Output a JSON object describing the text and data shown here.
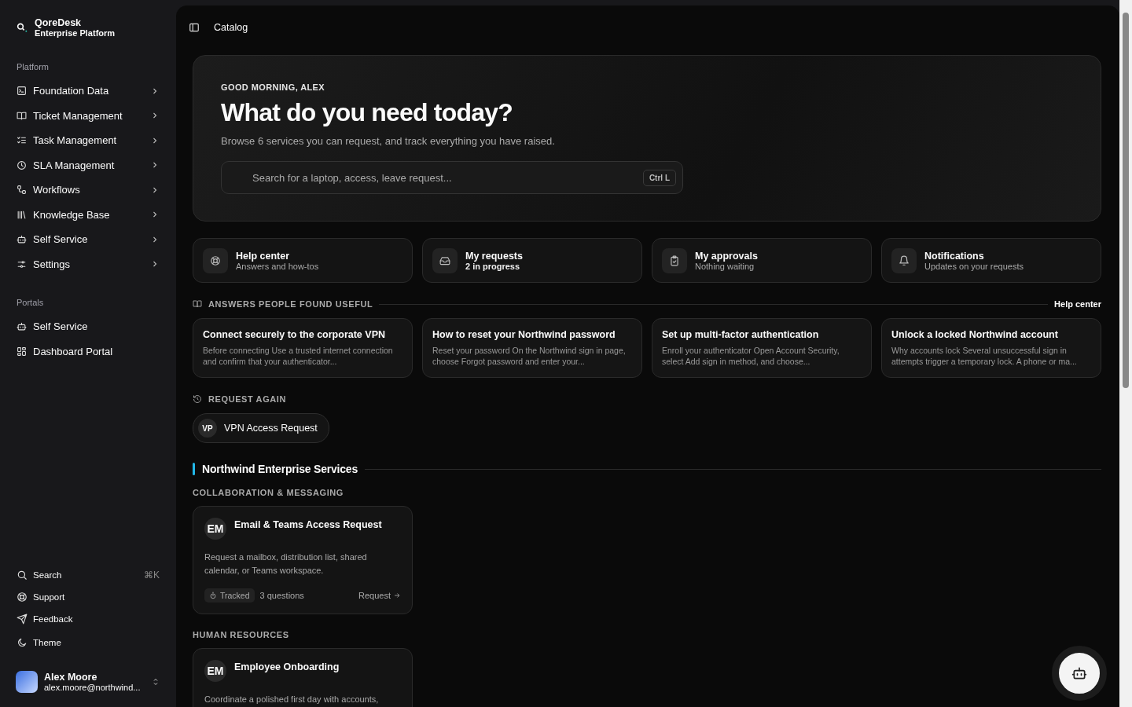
{
  "brand": {
    "name": "QoreDesk",
    "subtitle": "Enterprise Platform"
  },
  "sidebar": {
    "platform_label": "Platform",
    "platform_items": [
      {
        "label": "Foundation Data",
        "expanded": false
      },
      {
        "label": "Ticket Management",
        "expanded": false
      },
      {
        "label": "Task Management",
        "expanded": false
      },
      {
        "label": "SLA Management",
        "expanded": false
      },
      {
        "label": "Workflows",
        "expanded": false
      },
      {
        "label": "Knowledge Base",
        "expanded": false
      },
      {
        "label": "Self Service",
        "expanded": false
      },
      {
        "label": "Settings",
        "expanded": false
      }
    ],
    "portals_label": "Portals",
    "portal_items": [
      {
        "label": "Self Service"
      },
      {
        "label": "Dashboard Portal"
      }
    ],
    "footer_items": [
      {
        "label": "Search",
        "shortcut": "⌘K"
      },
      {
        "label": "Support"
      },
      {
        "label": "Feedback"
      },
      {
        "label": "Theme"
      }
    ],
    "user": {
      "name": "Alex Moore",
      "email": "alex.moore@northwind..."
    }
  },
  "header": {
    "title": "Catalog"
  },
  "hero": {
    "greeting": "GOOD MORNING, ALEX",
    "heading": "What do you need today?",
    "subtitle": "Browse 6 services you can request, and track everything you have raised.",
    "search": {
      "placeholder": "Search for a laptop, access, leave request...",
      "shortcut": "Ctrl L"
    }
  },
  "quick_links": [
    {
      "title": "Help center",
      "subtitle": "Answers and how-tos",
      "emphasis": false
    },
    {
      "title": "My requests",
      "subtitle": "2 in progress",
      "emphasis": true
    },
    {
      "title": "My approvals",
      "subtitle": "Nothing waiting",
      "emphasis": false
    },
    {
      "title": "Notifications",
      "subtitle": "Updates on your requests",
      "emphasis": false
    }
  ],
  "answers": {
    "heading": "ANSWERS PEOPLE FOUND USEFUL",
    "link": "Help center",
    "articles": [
      {
        "title": "Connect securely to the corporate VPN",
        "excerpt": "Before connecting Use a trusted internet connection and confirm that your authenticator..."
      },
      {
        "title": "How to reset your Northwind password",
        "excerpt": "Reset your password On the Northwind sign in page, choose Forgot password and enter your..."
      },
      {
        "title": "Set up multi-factor authentication",
        "excerpt": "Enroll your authenticator Open Account Security, select Add sign in method, and choose..."
      },
      {
        "title": "Unlock a locked Northwind account",
        "excerpt": "Why accounts lock Several unsuccessful sign in attempts trigger a temporary lock. A phone or ma..."
      }
    ]
  },
  "request_again": {
    "heading": "REQUEST AGAIN",
    "items": [
      {
        "initials": "VP",
        "label": "VPN Access Request"
      }
    ]
  },
  "catalog": {
    "title": "Northwind Enterprise Services",
    "categories": [
      {
        "name": "COLLABORATION & MESSAGING",
        "services": [
          {
            "initials": "EM",
            "title": "Email & Teams Access Request",
            "description": "Request a mailbox, distribution list, shared calendar, or Teams workspace.",
            "tag": "Tracked",
            "questions": "3 questions",
            "action": "Request"
          }
        ]
      },
      {
        "name": "HUMAN RESOURCES",
        "services": [
          {
            "initials": "EM",
            "title": "Employee Onboarding",
            "description": "Coordinate a polished first day with accounts,"
          }
        ]
      }
    ]
  }
}
